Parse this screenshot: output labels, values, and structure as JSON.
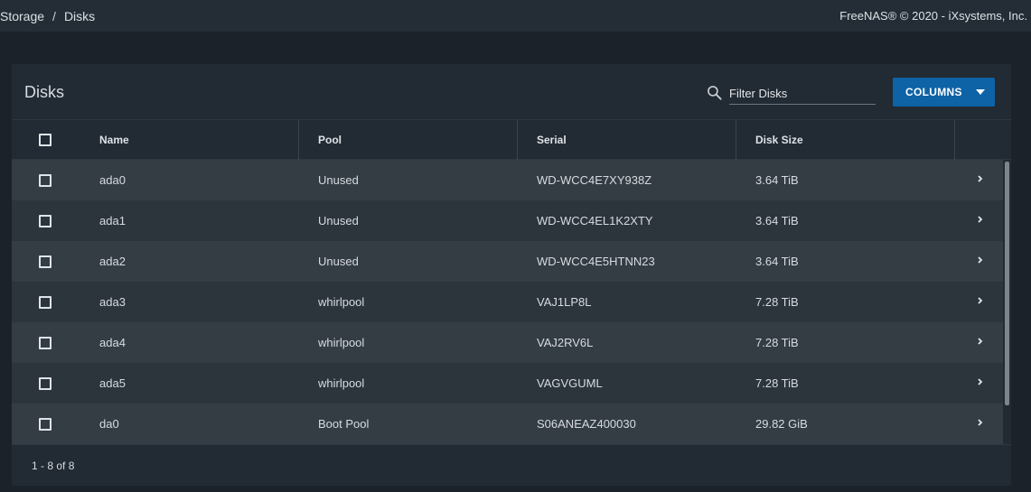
{
  "breadcrumb": {
    "items": [
      "Storage",
      "Disks"
    ],
    "separator": "/"
  },
  "copyright": "FreeNAS® © 2020 - iXsystems, Inc.",
  "card": {
    "title": "Disks",
    "search_placeholder": "Filter Disks",
    "columns_button": "COLUMNS"
  },
  "table": {
    "headers": [
      "Name",
      "Pool",
      "Serial",
      "Disk Size"
    ],
    "rows": [
      {
        "name": "ada0",
        "pool": "Unused",
        "serial": "WD-WCC4E7XY938Z",
        "size": "3.64 TiB"
      },
      {
        "name": "ada1",
        "pool": "Unused",
        "serial": "WD-WCC4EL1K2XTY",
        "size": "3.64 TiB"
      },
      {
        "name": "ada2",
        "pool": "Unused",
        "serial": "WD-WCC4E5HTNN23",
        "size": "3.64 TiB"
      },
      {
        "name": "ada3",
        "pool": "whirlpool",
        "serial": "VAJ1LP8L",
        "size": "7.28 TiB"
      },
      {
        "name": "ada4",
        "pool": "whirlpool",
        "serial": "VAJ2RV6L",
        "size": "7.28 TiB"
      },
      {
        "name": "ada5",
        "pool": "whirlpool",
        "serial": "VAGVGUML",
        "size": "7.28 TiB"
      },
      {
        "name": "da0",
        "pool": "Boot Pool",
        "serial": "S06ANEAZ400030",
        "size": "29.82 GiB"
      }
    ]
  },
  "pagination": {
    "range": "1 - 8 of 8"
  },
  "colors": {
    "accent": "#0e62a6",
    "background": "#1b222a",
    "card": "#222a33"
  },
  "icons": {
    "search": "search-icon",
    "row_expand": "chevron-right-icon",
    "dropdown": "caret-down-icon"
  }
}
